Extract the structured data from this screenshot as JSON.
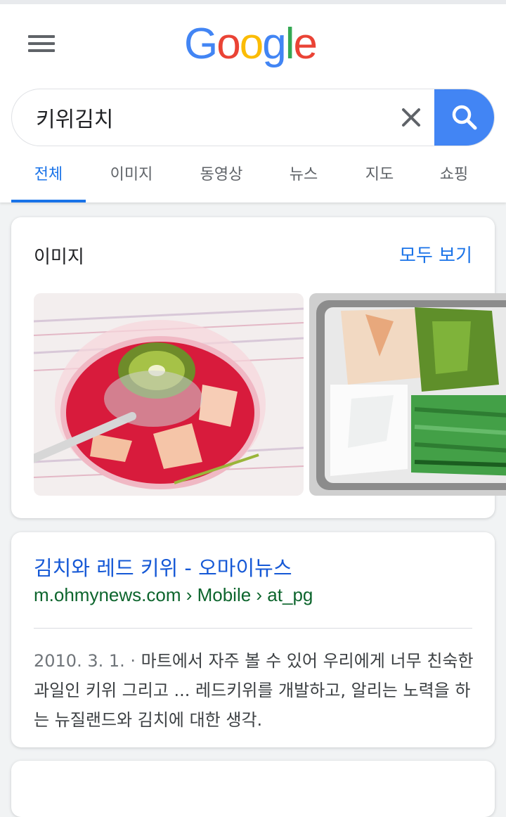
{
  "logo": {
    "letters": [
      "G",
      "o",
      "o",
      "g",
      "l",
      "e"
    ],
    "colors": [
      "#4285f4",
      "#ea4335",
      "#fbbc05",
      "#4285f4",
      "#34a853",
      "#ea4335"
    ]
  },
  "search": {
    "query": "키위김치",
    "clear_icon": "close-icon",
    "search_icon": "magnifier-icon",
    "accent": "#4285f4"
  },
  "tabs": [
    {
      "label": "전체",
      "active": true
    },
    {
      "label": "이미지"
    },
    {
      "label": "동영상"
    },
    {
      "label": "뉴스"
    },
    {
      "label": "지도"
    },
    {
      "label": "쇼핑"
    }
  ],
  "images_section": {
    "title": "이미지",
    "see_all": "모두 보기"
  },
  "result": {
    "title": "김치와 레드 키위 - 오마이뉴스",
    "url": "m.ohmynews.com › Mobile › at_pg",
    "date": "2010. 3. 1.",
    "separator": " · ",
    "snippet": "마트에서 자주 볼 수 있어 우리에게 너무 친숙한 과일인 키위 그리고 ... 레드키위를 개발하고, 알리는 노력을 하는 뉴질랜드와 김치에 대한 생각."
  },
  "colors": {
    "link": "#1558d6",
    "url": "#0d652d",
    "active_tab": "#1a73e8"
  }
}
